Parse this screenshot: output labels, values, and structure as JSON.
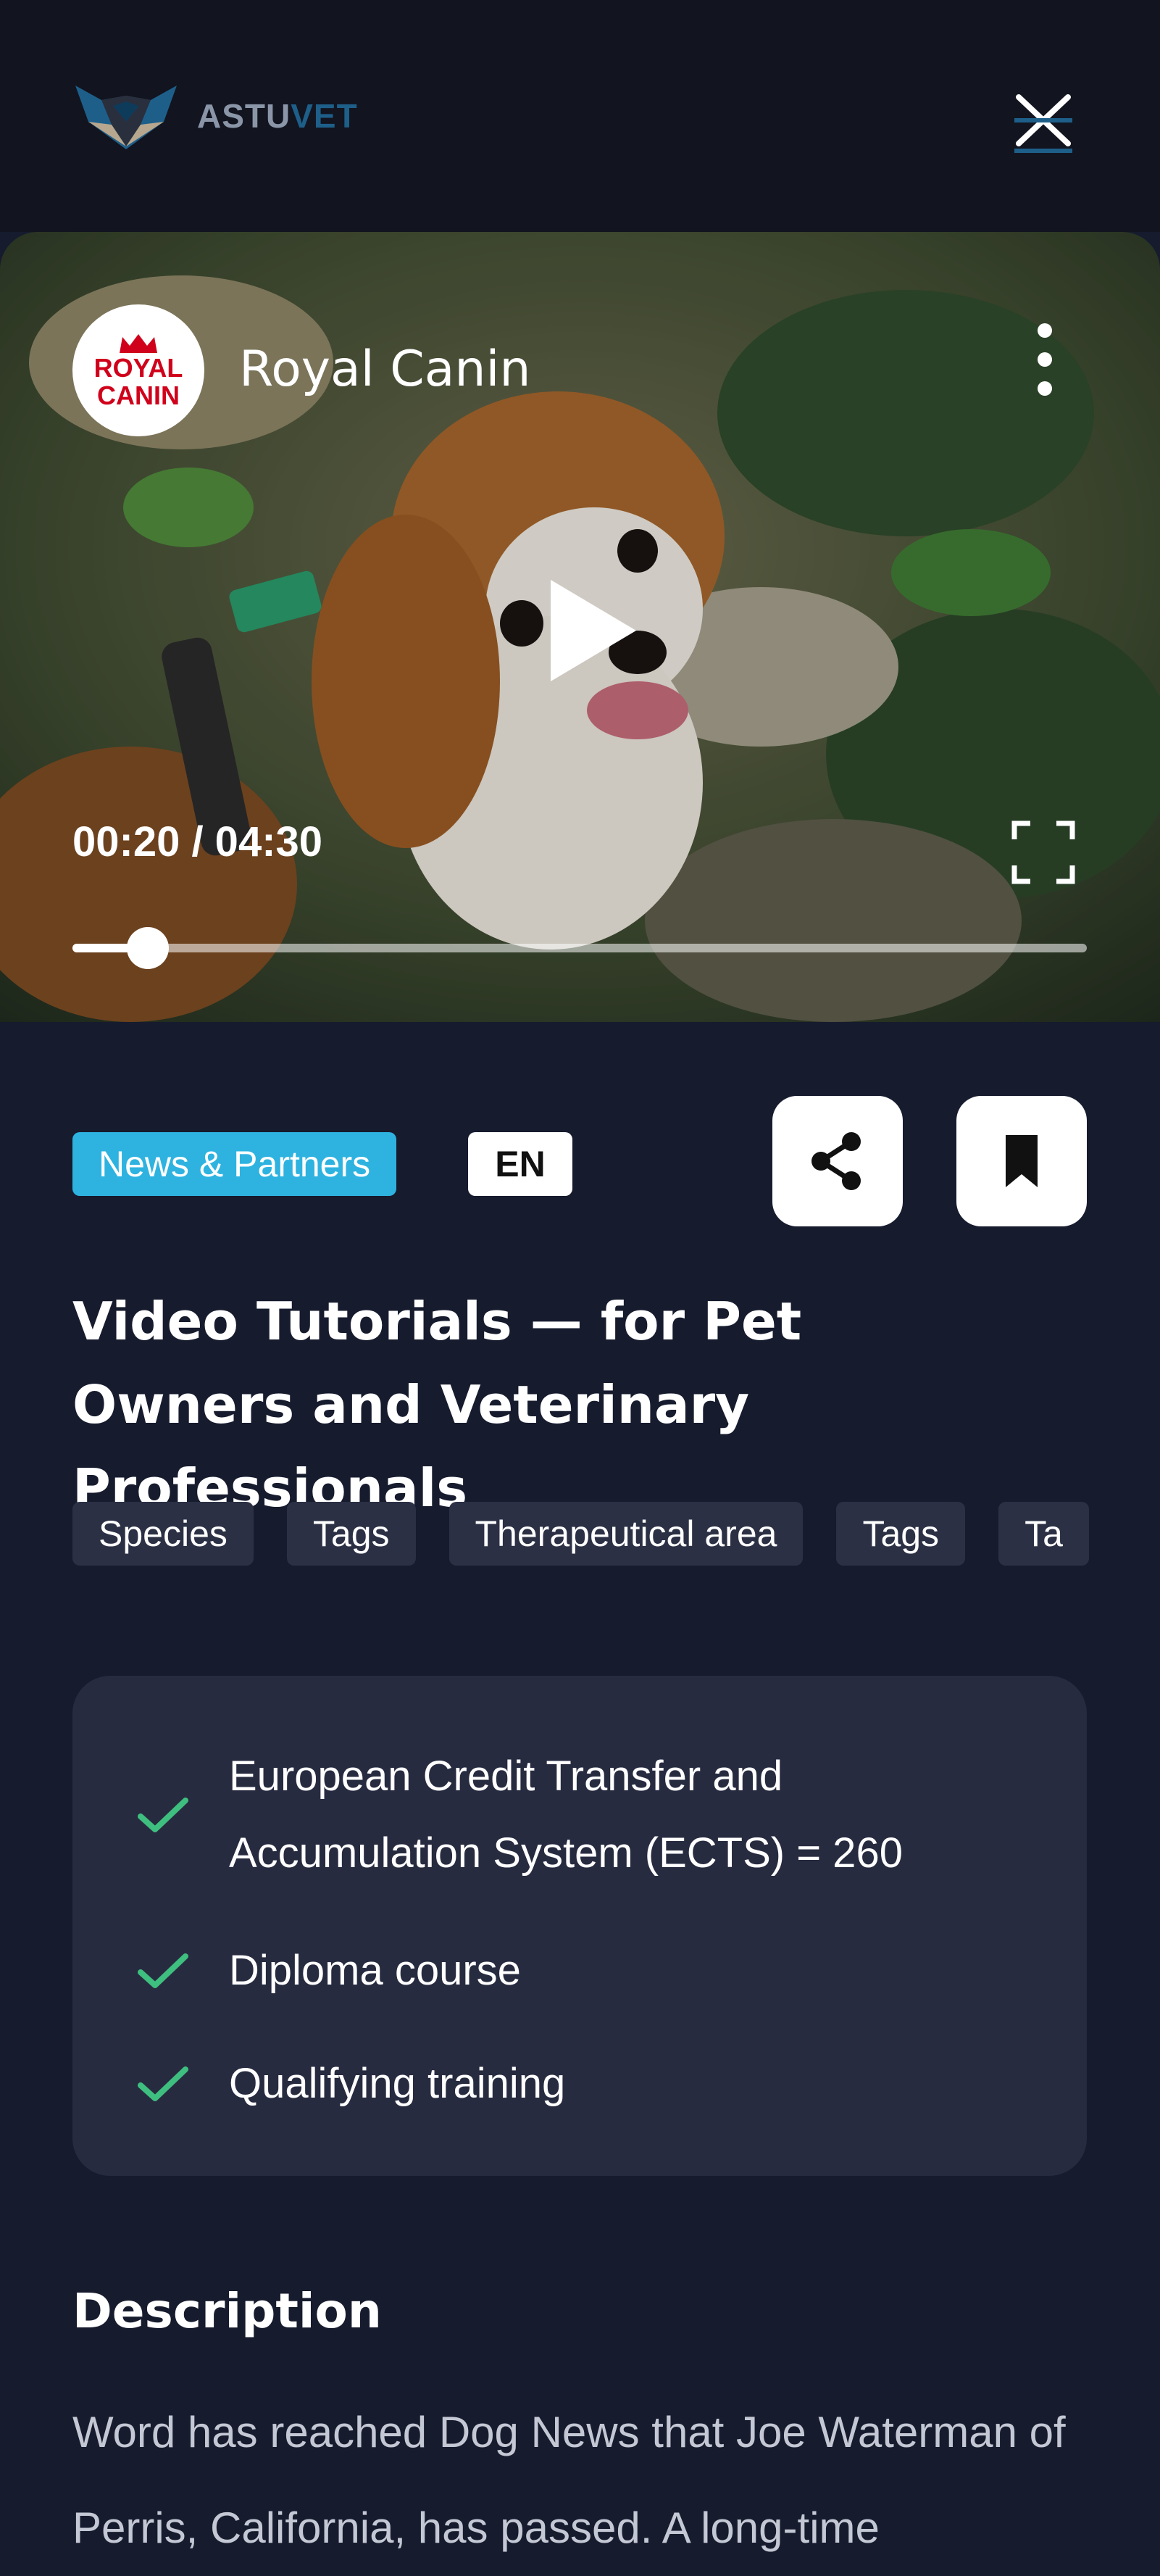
{
  "header": {
    "logo_text_part1": "ASTU",
    "logo_text_part2": "VET",
    "logo_icon": "fox-head-logo",
    "close_icon": "close-icon"
  },
  "video": {
    "channel_name": "Royal Canin",
    "channel_logo_text_line1": "ROYAL",
    "channel_logo_text_line2": "CANIN",
    "time_display": "00:20 / 04:30",
    "elapsed": "00:20",
    "duration": "04:30",
    "progress_fraction": 0.074,
    "icons": [
      "kebab-menu-icon",
      "play-icon",
      "fullscreen-icon"
    ]
  },
  "meta": {
    "category_chip": "News & Partners",
    "language_chip": "EN",
    "share_icon": "share-icon",
    "bookmark_icon": "bookmark-icon"
  },
  "title": "Video Tutorials — for Pet Owners and Veterinary Professionals",
  "tags": [
    "Species",
    "Tags",
    "Therapeutical area",
    "Tags",
    "Ta"
  ],
  "features": [
    "European Credit Transfer and Accumulation System (ECTS) = 260",
    "Diploma course",
    "Qualifying training"
  ],
  "description": {
    "heading": "Description",
    "text": "Word has reached Dog News that Joe Waterman of Perris, California, has passed. A long-time"
  },
  "colors": {
    "background": "#161b2e",
    "header": "#12141f",
    "card": "#272b40",
    "accent": "#2eb3e0",
    "check": "#3fbf7f",
    "brand_red": "#d0021b"
  }
}
